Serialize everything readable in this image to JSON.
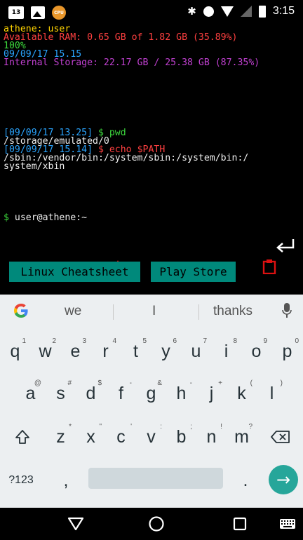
{
  "status_bar": {
    "notif_badge": "13",
    "cpu_label": "CPU",
    "time": "3:15",
    "bluetooth_glyph": "✱"
  },
  "terminal": {
    "lines": [
      {
        "text": "athene: user",
        "color": "yellow"
      },
      {
        "text": "Available RAM: 0.65 GB of 1.82 GB (35.89%)",
        "color": "red"
      },
      {
        "text": "100%",
        "color": "green"
      },
      {
        "text": "09/09/17 15.15",
        "color": "blue"
      },
      {
        "text": "Internal Storage: 22.17 GB / 25.38 GB (87.35%)",
        "color": "purple"
      }
    ],
    "cmd1_ts": "[09/09/17 13.25]",
    "cmd1_cmd": " $ pwd",
    "cmd1_out": "/storage/emulated/0",
    "cmd2_ts": "[09/09/17 15.14]",
    "cmd2_cmd": " $ echo $PATH",
    "cmd2_out1": "/sbin:/vendor/bin:/system/sbin:/system/bin:/",
    "cmd2_out2": "system/xbin",
    "prompt_sym": "$",
    "prompt_text": " user@athene:~"
  },
  "extra_keys": {
    "close": "✕",
    "up": "⌃",
    "down": "⌄"
  },
  "shortcuts": {
    "linux_cheatsheet": "Linux Cheatsheet",
    "play_store": "Play Store"
  },
  "keyboard": {
    "suggestions": [
      "we",
      "I",
      "thanks"
    ],
    "row1": [
      {
        "k": "q",
        "h": "1"
      },
      {
        "k": "w",
        "h": "2"
      },
      {
        "k": "e",
        "h": "3"
      },
      {
        "k": "r",
        "h": "4"
      },
      {
        "k": "t",
        "h": "5"
      },
      {
        "k": "y",
        "h": "6"
      },
      {
        "k": "u",
        "h": "7"
      },
      {
        "k": "i",
        "h": "8"
      },
      {
        "k": "o",
        "h": "9"
      },
      {
        "k": "p",
        "h": "0"
      }
    ],
    "row2": [
      {
        "k": "a",
        "h": "@"
      },
      {
        "k": "s",
        "h": "#"
      },
      {
        "k": "d",
        "h": "$"
      },
      {
        "k": "f",
        "h": "-"
      },
      {
        "k": "g",
        "h": "&"
      },
      {
        "k": "h",
        "h": "-"
      },
      {
        "k": "j",
        "h": "+"
      },
      {
        "k": "k",
        "h": "("
      },
      {
        "k": "l",
        "h": ")"
      }
    ],
    "row3": [
      {
        "k": "z",
        "h": "*"
      },
      {
        "k": "x",
        "h": "\""
      },
      {
        "k": "c",
        "h": "'"
      },
      {
        "k": "v",
        "h": ":"
      },
      {
        "k": "b",
        "h": ";"
      },
      {
        "k": "n",
        "h": "!"
      },
      {
        "k": "m",
        "h": "?"
      }
    ],
    "symbols_key": "?123",
    "comma_key": ",",
    "period_key": ".",
    "enter_glyph": "→"
  },
  "colors": {
    "accent_teal": "#00897b",
    "terminal_red": "#ff4040",
    "extra_key_red": "#dd1111"
  }
}
